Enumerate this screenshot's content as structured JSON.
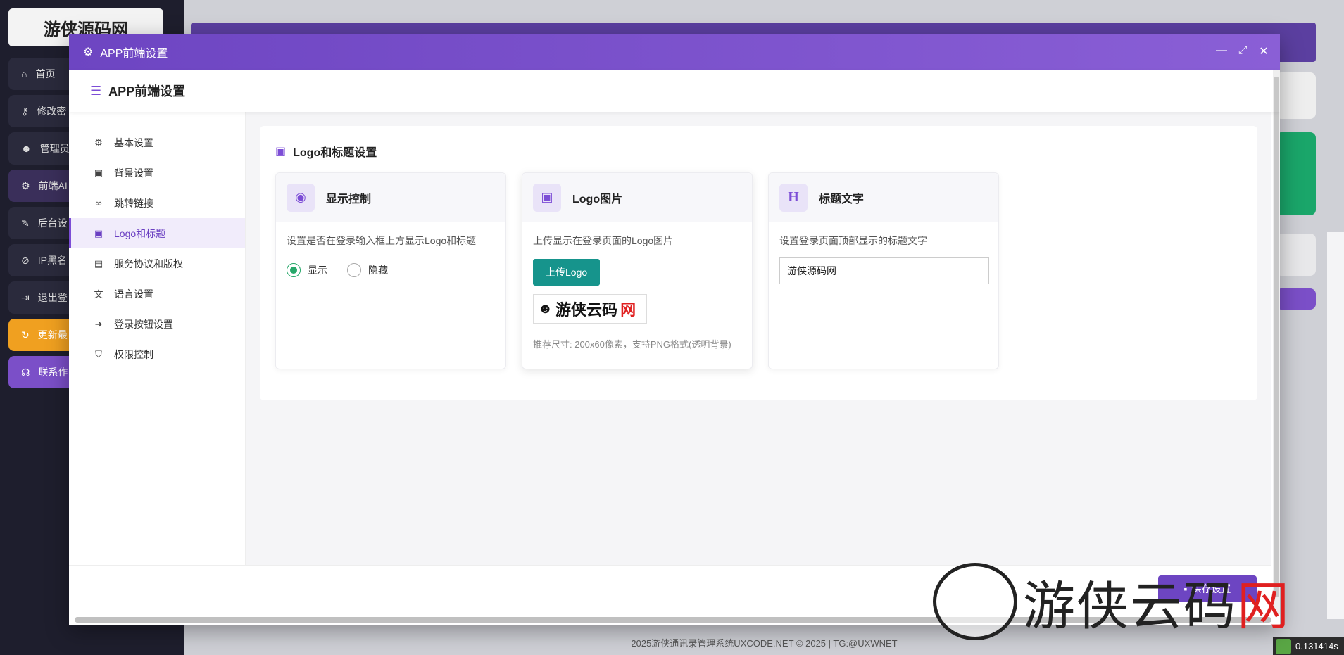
{
  "background": {
    "logo_text": "游侠源码网",
    "menu": [
      "首页",
      "修改密",
      "管理员",
      "前端AI",
      "后台设",
      "IP黑名",
      "退出登",
      "更新最",
      "联系作"
    ],
    "footer": "2025游侠通讯录管理系统UXCODE.NET © 2025 | TG:@UXWNET",
    "timer": "0.131414s"
  },
  "modal": {
    "title": "APP前端设置",
    "header": "APP前端设置",
    "window_controls": [
      "minimize-icon",
      "maximize-icon",
      "close-icon"
    ]
  },
  "nav": {
    "items": [
      {
        "label": "基本设置",
        "icon": "gear-icon"
      },
      {
        "label": "背景设置",
        "icon": "image-icon"
      },
      {
        "label": "跳转链接",
        "icon": "link-icon"
      },
      {
        "label": "Logo和标题",
        "icon": "image-icon",
        "active": true
      },
      {
        "label": "服务协议和版权",
        "icon": "document-icon"
      },
      {
        "label": "语言设置",
        "icon": "translate-icon"
      },
      {
        "label": "登录按钮设置",
        "icon": "sign-in-icon"
      },
      {
        "label": "权限控制",
        "icon": "shield-icon"
      }
    ]
  },
  "panel": {
    "title": "Logo和标题设置",
    "display_card": {
      "title": "显示控制",
      "desc": "设置是否在登录输入框上方显示Logo和标题",
      "options": [
        "显示",
        "隐藏"
      ],
      "selected": "显示"
    },
    "logo_card": {
      "title": "Logo图片",
      "desc": "上传显示在登录页面的Logo图片",
      "button": "上传Logo",
      "preview_text": "游侠云码",
      "preview_red": "网",
      "hint": "推荐尺寸: 200x60像素，支持PNG格式(透明背景)"
    },
    "title_card": {
      "title": "标题文字",
      "desc": "设置登录页面顶部显示的标题文字",
      "value": "游侠源码网"
    }
  },
  "footer": {
    "save": "保存设置"
  },
  "watermark": {
    "text": "游侠云码",
    "red": "网"
  },
  "colors": {
    "accent": "#6d45c2",
    "teal": "#16948c",
    "green": "#27a86a"
  }
}
